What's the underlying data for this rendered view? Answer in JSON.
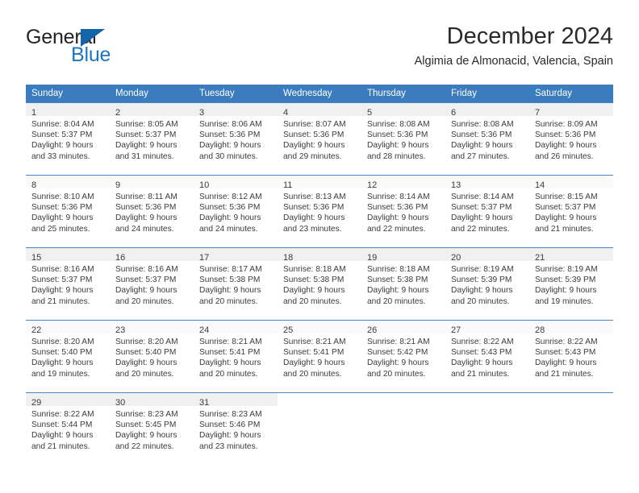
{
  "brand": {
    "name_part1": "General",
    "name_part2": "Blue",
    "triangle_color": "#1464aa",
    "blue_color": "#1b76c4"
  },
  "header": {
    "title": "December 2024",
    "subtitle": "Algimia de Almonacid, Valencia, Spain"
  },
  "theme": {
    "header_bg": "#3a7cbe",
    "header_text": "#ffffff",
    "daynum_band_bg": "#f0f0f0",
    "grid_line": "#4a86c4",
    "body_text": "#3b3b3b"
  },
  "weekdays": [
    "Sunday",
    "Monday",
    "Tuesday",
    "Wednesday",
    "Thursday",
    "Friday",
    "Saturday"
  ],
  "weeks": [
    [
      {
        "day": "1",
        "sunrise": "Sunrise: 8:04 AM",
        "sunset": "Sunset: 5:37 PM",
        "daylight1": "Daylight: 9 hours",
        "daylight2": "and 33 minutes."
      },
      {
        "day": "2",
        "sunrise": "Sunrise: 8:05 AM",
        "sunset": "Sunset: 5:37 PM",
        "daylight1": "Daylight: 9 hours",
        "daylight2": "and 31 minutes."
      },
      {
        "day": "3",
        "sunrise": "Sunrise: 8:06 AM",
        "sunset": "Sunset: 5:36 PM",
        "daylight1": "Daylight: 9 hours",
        "daylight2": "and 30 minutes."
      },
      {
        "day": "4",
        "sunrise": "Sunrise: 8:07 AM",
        "sunset": "Sunset: 5:36 PM",
        "daylight1": "Daylight: 9 hours",
        "daylight2": "and 29 minutes."
      },
      {
        "day": "5",
        "sunrise": "Sunrise: 8:08 AM",
        "sunset": "Sunset: 5:36 PM",
        "daylight1": "Daylight: 9 hours",
        "daylight2": "and 28 minutes."
      },
      {
        "day": "6",
        "sunrise": "Sunrise: 8:08 AM",
        "sunset": "Sunset: 5:36 PM",
        "daylight1": "Daylight: 9 hours",
        "daylight2": "and 27 minutes."
      },
      {
        "day": "7",
        "sunrise": "Sunrise: 8:09 AM",
        "sunset": "Sunset: 5:36 PM",
        "daylight1": "Daylight: 9 hours",
        "daylight2": "and 26 minutes."
      }
    ],
    [
      {
        "day": "8",
        "sunrise": "Sunrise: 8:10 AM",
        "sunset": "Sunset: 5:36 PM",
        "daylight1": "Daylight: 9 hours",
        "daylight2": "and 25 minutes."
      },
      {
        "day": "9",
        "sunrise": "Sunrise: 8:11 AM",
        "sunset": "Sunset: 5:36 PM",
        "daylight1": "Daylight: 9 hours",
        "daylight2": "and 24 minutes."
      },
      {
        "day": "10",
        "sunrise": "Sunrise: 8:12 AM",
        "sunset": "Sunset: 5:36 PM",
        "daylight1": "Daylight: 9 hours",
        "daylight2": "and 24 minutes."
      },
      {
        "day": "11",
        "sunrise": "Sunrise: 8:13 AM",
        "sunset": "Sunset: 5:36 PM",
        "daylight1": "Daylight: 9 hours",
        "daylight2": "and 23 minutes."
      },
      {
        "day": "12",
        "sunrise": "Sunrise: 8:14 AM",
        "sunset": "Sunset: 5:36 PM",
        "daylight1": "Daylight: 9 hours",
        "daylight2": "and 22 minutes."
      },
      {
        "day": "13",
        "sunrise": "Sunrise: 8:14 AM",
        "sunset": "Sunset: 5:37 PM",
        "daylight1": "Daylight: 9 hours",
        "daylight2": "and 22 minutes."
      },
      {
        "day": "14",
        "sunrise": "Sunrise: 8:15 AM",
        "sunset": "Sunset: 5:37 PM",
        "daylight1": "Daylight: 9 hours",
        "daylight2": "and 21 minutes."
      }
    ],
    [
      {
        "day": "15",
        "sunrise": "Sunrise: 8:16 AM",
        "sunset": "Sunset: 5:37 PM",
        "daylight1": "Daylight: 9 hours",
        "daylight2": "and 21 minutes."
      },
      {
        "day": "16",
        "sunrise": "Sunrise: 8:16 AM",
        "sunset": "Sunset: 5:37 PM",
        "daylight1": "Daylight: 9 hours",
        "daylight2": "and 20 minutes."
      },
      {
        "day": "17",
        "sunrise": "Sunrise: 8:17 AM",
        "sunset": "Sunset: 5:38 PM",
        "daylight1": "Daylight: 9 hours",
        "daylight2": "and 20 minutes."
      },
      {
        "day": "18",
        "sunrise": "Sunrise: 8:18 AM",
        "sunset": "Sunset: 5:38 PM",
        "daylight1": "Daylight: 9 hours",
        "daylight2": "and 20 minutes."
      },
      {
        "day": "19",
        "sunrise": "Sunrise: 8:18 AM",
        "sunset": "Sunset: 5:38 PM",
        "daylight1": "Daylight: 9 hours",
        "daylight2": "and 20 minutes."
      },
      {
        "day": "20",
        "sunrise": "Sunrise: 8:19 AM",
        "sunset": "Sunset: 5:39 PM",
        "daylight1": "Daylight: 9 hours",
        "daylight2": "and 20 minutes."
      },
      {
        "day": "21",
        "sunrise": "Sunrise: 8:19 AM",
        "sunset": "Sunset: 5:39 PM",
        "daylight1": "Daylight: 9 hours",
        "daylight2": "and 19 minutes."
      }
    ],
    [
      {
        "day": "22",
        "sunrise": "Sunrise: 8:20 AM",
        "sunset": "Sunset: 5:40 PM",
        "daylight1": "Daylight: 9 hours",
        "daylight2": "and 19 minutes."
      },
      {
        "day": "23",
        "sunrise": "Sunrise: 8:20 AM",
        "sunset": "Sunset: 5:40 PM",
        "daylight1": "Daylight: 9 hours",
        "daylight2": "and 20 minutes."
      },
      {
        "day": "24",
        "sunrise": "Sunrise: 8:21 AM",
        "sunset": "Sunset: 5:41 PM",
        "daylight1": "Daylight: 9 hours",
        "daylight2": "and 20 minutes."
      },
      {
        "day": "25",
        "sunrise": "Sunrise: 8:21 AM",
        "sunset": "Sunset: 5:41 PM",
        "daylight1": "Daylight: 9 hours",
        "daylight2": "and 20 minutes."
      },
      {
        "day": "26",
        "sunrise": "Sunrise: 8:21 AM",
        "sunset": "Sunset: 5:42 PM",
        "daylight1": "Daylight: 9 hours",
        "daylight2": "and 20 minutes."
      },
      {
        "day": "27",
        "sunrise": "Sunrise: 8:22 AM",
        "sunset": "Sunset: 5:43 PM",
        "daylight1": "Daylight: 9 hours",
        "daylight2": "and 21 minutes."
      },
      {
        "day": "28",
        "sunrise": "Sunrise: 8:22 AM",
        "sunset": "Sunset: 5:43 PM",
        "daylight1": "Daylight: 9 hours",
        "daylight2": "and 21 minutes."
      }
    ],
    [
      {
        "day": "29",
        "sunrise": "Sunrise: 8:22 AM",
        "sunset": "Sunset: 5:44 PM",
        "daylight1": "Daylight: 9 hours",
        "daylight2": "and 21 minutes."
      },
      {
        "day": "30",
        "sunrise": "Sunrise: 8:23 AM",
        "sunset": "Sunset: 5:45 PM",
        "daylight1": "Daylight: 9 hours",
        "daylight2": "and 22 minutes."
      },
      {
        "day": "31",
        "sunrise": "Sunrise: 8:23 AM",
        "sunset": "Sunset: 5:46 PM",
        "daylight1": "Daylight: 9 hours",
        "daylight2": "and 23 minutes."
      },
      {
        "day": "",
        "sunrise": "",
        "sunset": "",
        "daylight1": "",
        "daylight2": ""
      },
      {
        "day": "",
        "sunrise": "",
        "sunset": "",
        "daylight1": "",
        "daylight2": ""
      },
      {
        "day": "",
        "sunrise": "",
        "sunset": "",
        "daylight1": "",
        "daylight2": ""
      },
      {
        "day": "",
        "sunrise": "",
        "sunset": "",
        "daylight1": "",
        "daylight2": ""
      }
    ]
  ]
}
